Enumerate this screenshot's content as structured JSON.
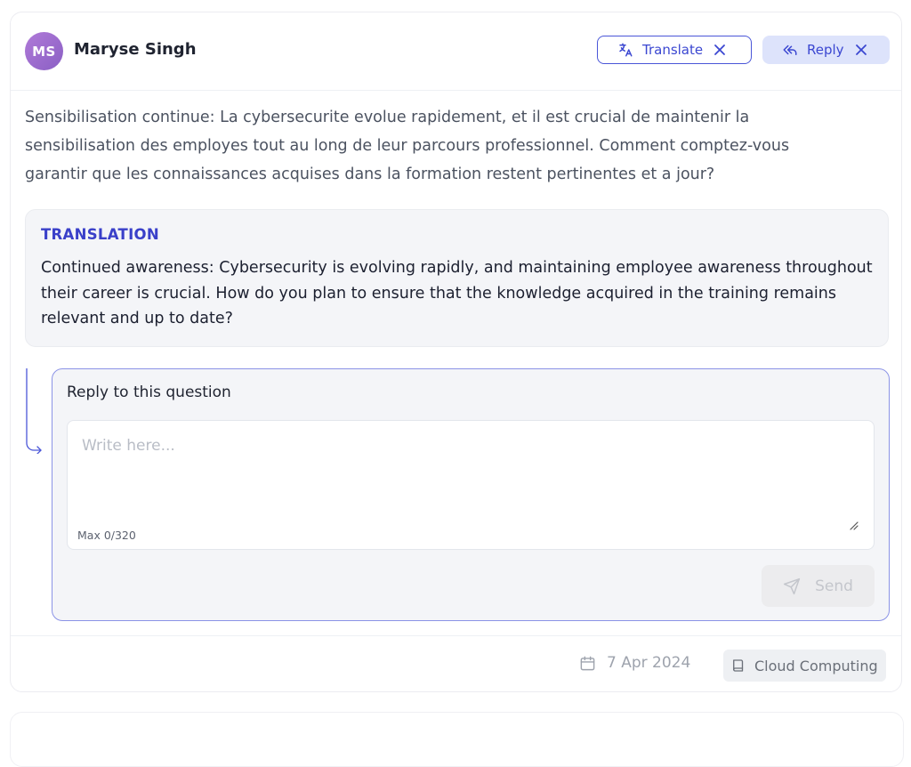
{
  "author": {
    "initials": "MS",
    "name": "Maryse Singh"
  },
  "actions": {
    "translate_label": "Translate",
    "reply_label": "Reply"
  },
  "question": {
    "text": "Sensibilisation continue: La cybersecurite evolue rapidement, et il est crucial de maintenir la sensibilisation des employes tout au long de leur parcours professionnel. Comment comptez-vous garantir que les connaissances acquises dans la formation restent pertinentes et a jour?"
  },
  "translation": {
    "heading": "TRANSLATION",
    "text": "Continued awareness: Cybersecurity is evolving rapidly, and maintaining employee awareness throughout their career is crucial. How do you plan to ensure that the knowledge acquired in the training remains relevant and up to date?"
  },
  "reply": {
    "title": "Reply to this question",
    "placeholder": "Write here...",
    "value": "",
    "counter": "Max 0/320",
    "send_label": "Send"
  },
  "footer": {
    "date": "7 Apr 2024",
    "tag": "Cloud Computing"
  },
  "colors": {
    "accent": "#3b47d1",
    "reply_button_bg": "#dde3fb",
    "reply_box_border": "#8b93e6",
    "avatar_gradient_start": "#b07ad8",
    "avatar_gradient_end": "#8a5fc4"
  },
  "icons": {
    "translate": "translate-icon",
    "reply": "reply-arrow-icon",
    "close": "close-icon",
    "send": "send-icon",
    "calendar": "calendar-icon",
    "book": "book-icon"
  }
}
